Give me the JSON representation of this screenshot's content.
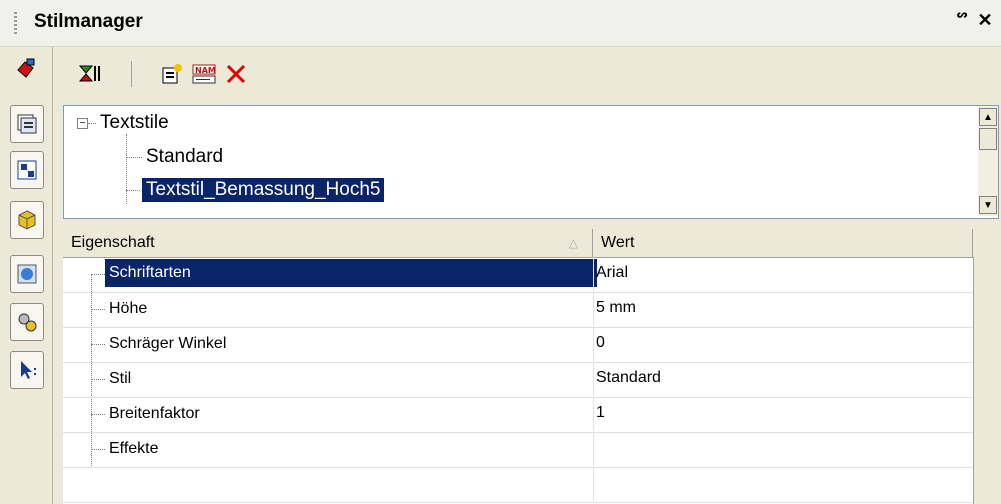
{
  "panel": {
    "title": "Stilmanager",
    "pin_glyph": "ᔥ",
    "close_glyph": "✕"
  },
  "tree": {
    "root": "Textstile",
    "children": [
      "Standard",
      "Textstil_Bemassung_Hoch5"
    ],
    "selected": "Textstil_Bemassung_Hoch5"
  },
  "grid": {
    "headers": {
      "property": "Eigenschaft",
      "value": "Wert"
    },
    "rows": [
      {
        "name": "Schriftarten",
        "value": "Arial"
      },
      {
        "name": "Höhe",
        "value": "5 mm"
      },
      {
        "name": "Schräger Winkel",
        "value": "0"
      },
      {
        "name": "Stil",
        "value": "Standard"
      },
      {
        "name": "Breitenfaktor",
        "value": "1"
      },
      {
        "name": "Effekte",
        "value": ""
      }
    ],
    "selected_row": "Schriftarten"
  },
  "colors": {
    "selection": "#0a246a",
    "delete_red": "#e00000"
  }
}
